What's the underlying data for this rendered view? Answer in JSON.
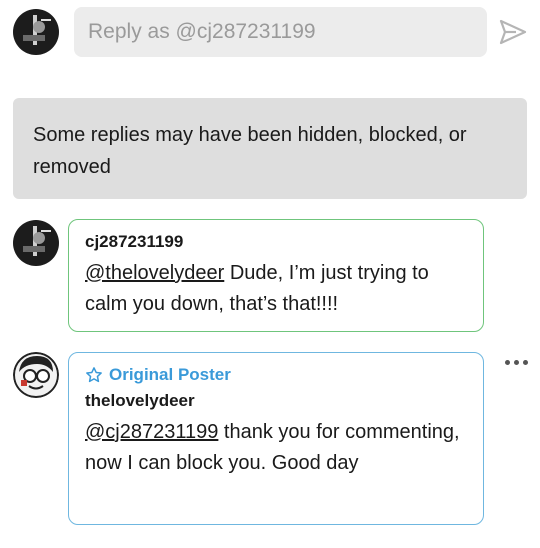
{
  "reply_bar": {
    "placeholder": "Reply as @cj287231199",
    "send_icon": "send-arrow-icon"
  },
  "notice": {
    "text": "Some replies may have been hidden, blocked, or removed"
  },
  "comments": [
    {
      "username": "cj287231199",
      "mention": "@thelovelydeer",
      "text": " Dude, I’m just trying to calm you down, that’s that!!!!",
      "border_color": "#6fc57c"
    },
    {
      "badge": "Original Poster",
      "badge_icon": "star-outline-icon",
      "username": "thelovelydeer",
      "mention": "@cj287231199",
      "text": " thank you for commenting, now I can block you. Good day",
      "border_color": "#6fb7e0",
      "more_icon": "more-options-icon"
    }
  ],
  "colors": {
    "notice_bg": "#dedede",
    "input_bg": "#ececec",
    "op_accent": "#3a9ad9",
    "reply_border_green": "#6fc57c"
  }
}
